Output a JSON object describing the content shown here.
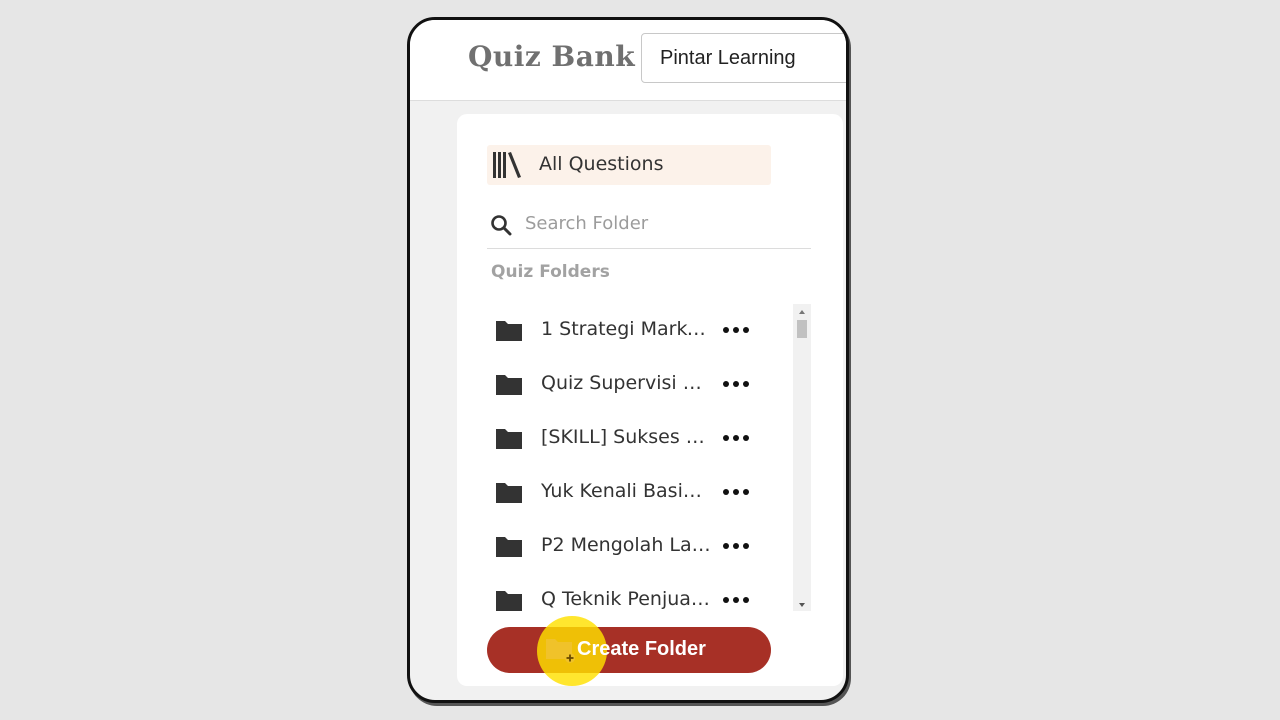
{
  "header": {
    "title": "Quiz Bank",
    "organization": "Pintar Learning"
  },
  "sidebar": {
    "all_questions": {
      "label": "All Questions",
      "icon": "books-icon"
    },
    "search": {
      "placeholder": "Search Folder",
      "value": "",
      "icon": "search-icon"
    },
    "section_title": "Quiz Folders",
    "folders": [
      {
        "name": "1 Strategi Marke…",
        "icon": "folder-icon",
        "menu_icon": "more-icon"
      },
      {
        "name": "Quiz Supervisi P…",
        "icon": "folder-icon",
        "menu_icon": "more-icon"
      },
      {
        "name": "[SKILL] Sukses …",
        "icon": "folder-icon",
        "menu_icon": "more-icon"
      },
      {
        "name": "Yuk Kenali Basi…",
        "icon": "folder-icon",
        "menu_icon": "more-icon"
      },
      {
        "name": "P2 Mengolah La…",
        "icon": "folder-icon",
        "menu_icon": "more-icon"
      },
      {
        "name": "Q Teknik Penjua…",
        "icon": "folder-icon",
        "menu_icon": "more-icon"
      }
    ],
    "create_button": {
      "label": "Create Folder",
      "icon": "folder-plus-icon"
    }
  },
  "colors": {
    "accent": "#a73026",
    "selected_bg": "#fcf2ea",
    "cursor_highlight": "#ffe000",
    "page_bg": "#e6e6e6"
  }
}
